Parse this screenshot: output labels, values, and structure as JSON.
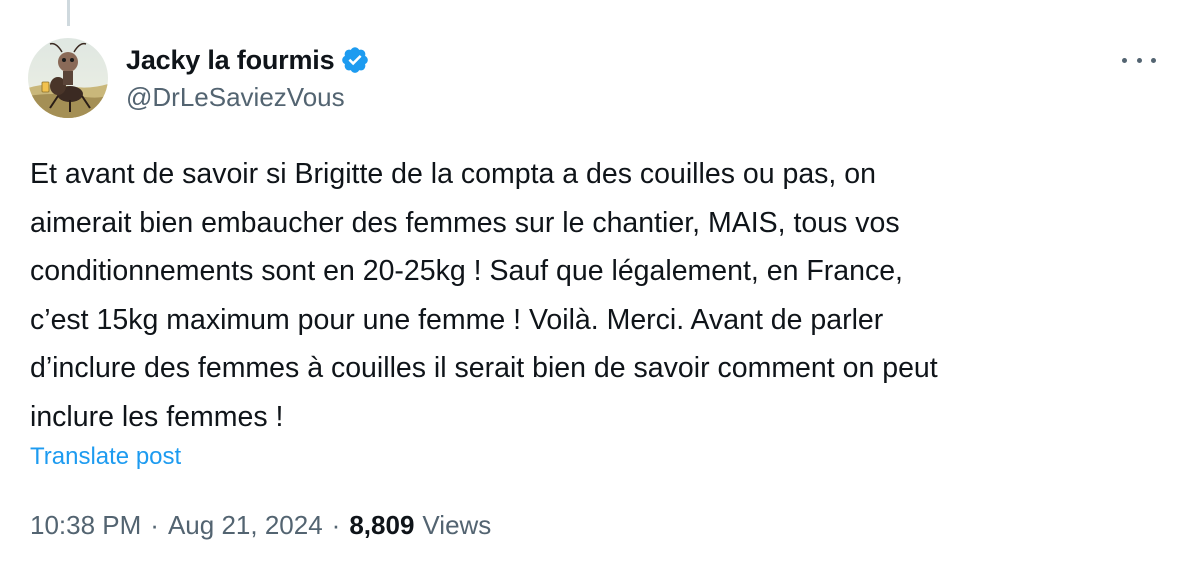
{
  "author": {
    "display_name": "Jacky la fourmis",
    "handle": "@DrLeSaviezVous",
    "verified": true,
    "verified_color": "#1d9bf0",
    "avatar_icon": "ant-cartoon-avatar"
  },
  "post": {
    "lines": [
      "Et avant de savoir si Brigitte de la compta a des couilles ou pas, on",
      "aimerait bien embaucher des femmes sur le chantier, MAIS, tous vos",
      "conditionnements sont en 20-25kg ! Sauf que légalement, en France,",
      "c’est 15kg maximum pour une femme ! Voilà. Merci. Avant de parler",
      "d’inclure des femmes à couilles il serait bien de savoir comment on peut",
      "inclure les femmes !"
    ],
    "translate_label": "Translate post"
  },
  "meta": {
    "time": "10:38 PM",
    "separator": "·",
    "date": "Aug 21, 2024",
    "views_count": "8,809",
    "views_label": "Views"
  },
  "colors": {
    "text": "#0f1419",
    "secondary": "#536471",
    "link": "#1d9bf0"
  }
}
